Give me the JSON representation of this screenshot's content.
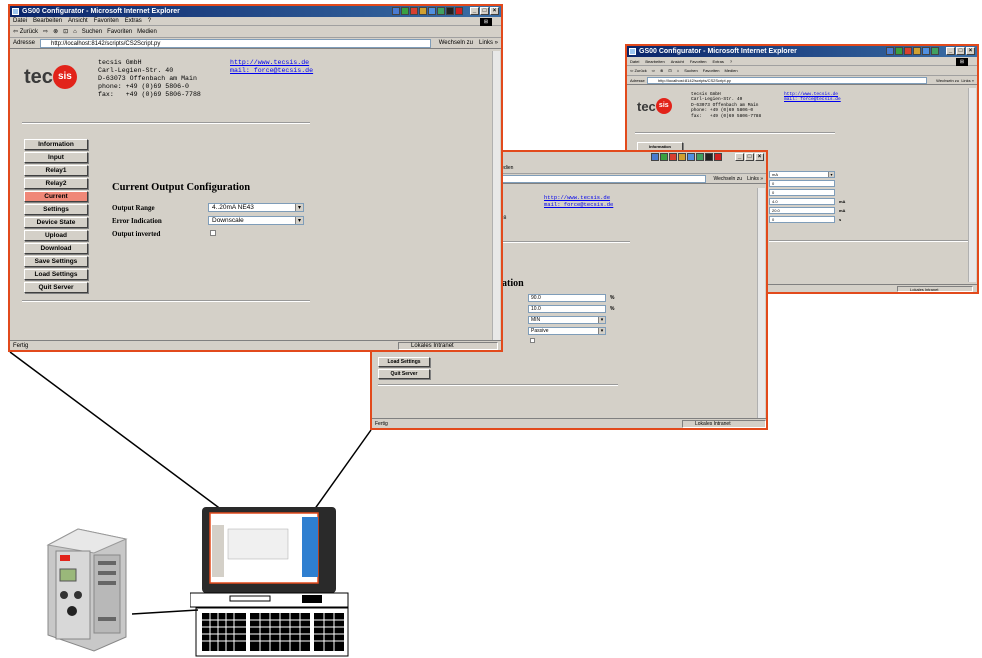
{
  "ie": {
    "window_title": "GS00 Configurator - Microsoft Internet Explorer",
    "menu": [
      "Datei",
      "Bearbeiten",
      "Ansicht",
      "Favoriten",
      "Extras",
      "?"
    ],
    "toolbar": [
      "⇦ Zurück",
      "⇨",
      "⊗",
      "⊡",
      "⌂",
      "Suchen",
      "Favoriten",
      "Medien"
    ],
    "address_label": "Adresse",
    "address_url": "http://localhost:8142/scripts/CS2Script.py",
    "go_label": "Wechseln zu",
    "links_label": "Links »",
    "status_done": "Fertig",
    "status_zone": "Lokales Intranet"
  },
  "company": {
    "text": "tecsis GmbH\nCarl-Legien-Str. 40\nD-63073 Offenbach am Main\nphone: +49 (0)69 5806-0\nfax:   +49 (0)69 5806-7788",
    "web": "http://www.tecsis.de",
    "mail": "mail: force@tecsis.de",
    "logo_tec": "tec",
    "logo_sis": "sis"
  },
  "nav": [
    "Information",
    "Input",
    "Relay1",
    "Relay2",
    "Current",
    "Settings",
    "Device State",
    "Upload",
    "Download",
    "Save Settings",
    "Load Settings",
    "Quit Server"
  ],
  "nav_active": "Current",
  "form": {
    "title": "Current Output Configuration",
    "rows": [
      {
        "label": "Output Range",
        "value": "4..20mA NE43"
      },
      {
        "label": "Error Indication",
        "value": "Downscale"
      },
      {
        "label": "Output inverted",
        "value": ""
      }
    ]
  },
  "mid_window": {
    "company_tail": "Main\n-0\n-7788",
    "title_tail": "uration",
    "fields": [
      {
        "value": "90.0",
        "unit": "%"
      },
      {
        "value": "10.0",
        "unit": "%"
      },
      {
        "value": "MIN",
        "unit": ""
      },
      {
        "value": "Passive",
        "unit": ""
      }
    ],
    "nav": [
      "Load Settings",
      "Quit Server"
    ]
  },
  "back_window": {
    "nav": [
      "Information"
    ],
    "fields": [
      {
        "value": "mA",
        "unit": ""
      },
      {
        "value": "0",
        "unit": ""
      },
      {
        "value": "0",
        "unit": ""
      },
      {
        "value": "4.0",
        "unit": "mA"
      },
      {
        "value": "20.0",
        "unit": "mA"
      },
      {
        "value": "0",
        "unit": "s"
      }
    ]
  },
  "colors": {
    "highlight_border": "#e24a1c",
    "active_nav": "#f08878",
    "ie_title": "#0a246a"
  }
}
